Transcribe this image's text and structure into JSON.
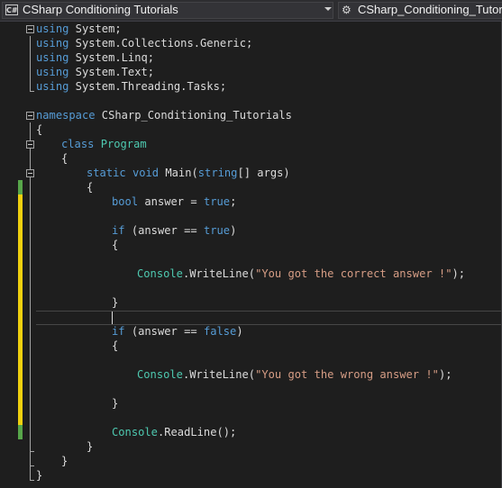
{
  "navigation_bar": {
    "project_label": "CSharp Conditioning Tutorials",
    "namespace_label": "CSharp_Conditioning_Tutorials"
  },
  "code": {
    "l1": {
      "k": "using",
      "t": " System;"
    },
    "l2": {
      "k": "using",
      "t": " System.Collections.Generic;"
    },
    "l3": {
      "k": "using",
      "t": " System.Linq;"
    },
    "l4": {
      "k": "using",
      "t": " System.Text;"
    },
    "l5": {
      "k": "using",
      "t": " System.Threading.Tasks;"
    },
    "l7": {
      "k": "namespace",
      "t": " CSharp_Conditioning_Tutorials"
    },
    "l8": "{",
    "l9": {
      "k": "class",
      "ty": "Program"
    },
    "l10": "{",
    "l11": {
      "k1": "static",
      "k2": "void",
      "t1": " Main(",
      "k3": "string",
      "t2": "[] args)"
    },
    "l12": "{",
    "l13": {
      "k": "bool",
      "t1": " answer = ",
      "k2": "true",
      "t2": ";"
    },
    "l15": {
      "k": "if",
      "t1": " (answer == ",
      "k2": "true",
      "t2": ")"
    },
    "l16": "{",
    "l18": {
      "ty": "Console",
      "t1": ".WriteLine(",
      "s": "\"You got the correct answer !\"",
      "t2": ");"
    },
    "l20": "}",
    "l22": {
      "k": "if",
      "t1": " (answer == ",
      "k2": "false",
      "t2": ")"
    },
    "l23": "{",
    "l25": {
      "ty": "Console",
      "t1": ".WriteLine(",
      "s": "\"You got the wrong answer !\"",
      "t2": ");"
    },
    "l27": "}",
    "l29": {
      "ty": "Console",
      "t": ".ReadLine();"
    },
    "l30": "}",
    "l31": "}",
    "l32": "}"
  },
  "colors": {
    "background": "#1e1e1e",
    "keyword": "#569cd6",
    "type": "#4ec9b0",
    "string": "#d69d85",
    "plain": "#dcdcdc",
    "change_unsaved": "#efd00f",
    "change_saved": "#57a64a"
  },
  "icons": [
    "csharp-file-icon",
    "project-icon",
    "chevron-down-icon"
  ]
}
